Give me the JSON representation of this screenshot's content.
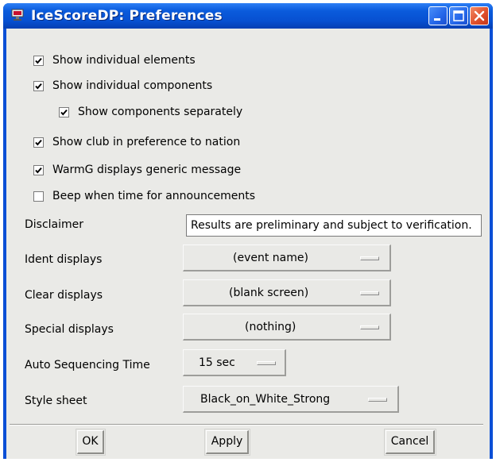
{
  "window": {
    "title": "IceScoreDP: Preferences",
    "titlebar_color": "#0a5bdc",
    "controls": [
      "minimize-icon",
      "maximize-icon",
      "close-icon"
    ]
  },
  "checkboxes": [
    {
      "label": "Show individual elements",
      "checked": true
    },
    {
      "label": "Show individual components",
      "checked": true
    },
    {
      "label": "Show components separately",
      "checked": true
    },
    {
      "label": "Show club in preference to nation",
      "checked": true
    },
    {
      "label": "WarmG displays generic message",
      "checked": true
    },
    {
      "label": "Beep when time for announcements",
      "checked": false
    }
  ],
  "disclaimer": {
    "label": "Disclaimer",
    "value": "Results are preliminary and subject to verification."
  },
  "options": {
    "ident": {
      "label": "Ident displays",
      "value": "(event name)"
    },
    "clear": {
      "label": "Clear displays",
      "value": "(blank screen)"
    },
    "special": {
      "label": "Special displays",
      "value": "(nothing)"
    },
    "autoseq": {
      "label": "Auto Sequencing Time",
      "value": "15 sec"
    },
    "style": {
      "label": "Style sheet",
      "value": "Black_on_White_Strong"
    }
  },
  "buttons": {
    "ok": "OK",
    "apply": "Apply",
    "cancel": "Cancel"
  }
}
